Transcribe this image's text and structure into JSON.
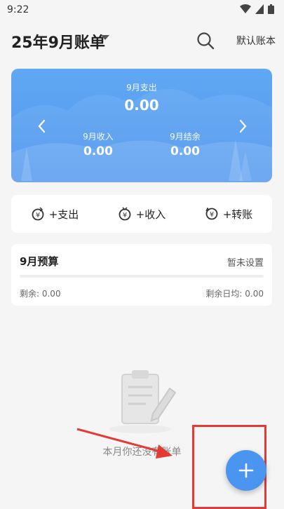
{
  "status_bar": {
    "time": "9:22"
  },
  "header": {
    "title": "25年9月账单",
    "ledger_label": "默认账本"
  },
  "summary": {
    "expense_label": "9月支出",
    "expense_value": "0.00",
    "income_label": "9月收入",
    "income_value": "0.00",
    "balance_label": "9月结余",
    "balance_value": "0.00"
  },
  "actions": [
    {
      "label": "+支出"
    },
    {
      "label": "+收入"
    },
    {
      "label": "+转账"
    }
  ],
  "budget": {
    "title": "9月预算",
    "setting": "暂未设置",
    "remaining": "剩余: 0.00",
    "daily": "剩余日均: 0.00"
  },
  "empty": {
    "text": "本月你还没有账单"
  },
  "colors": {
    "primary": "#4a95ef",
    "highlight": "#e53935"
  }
}
